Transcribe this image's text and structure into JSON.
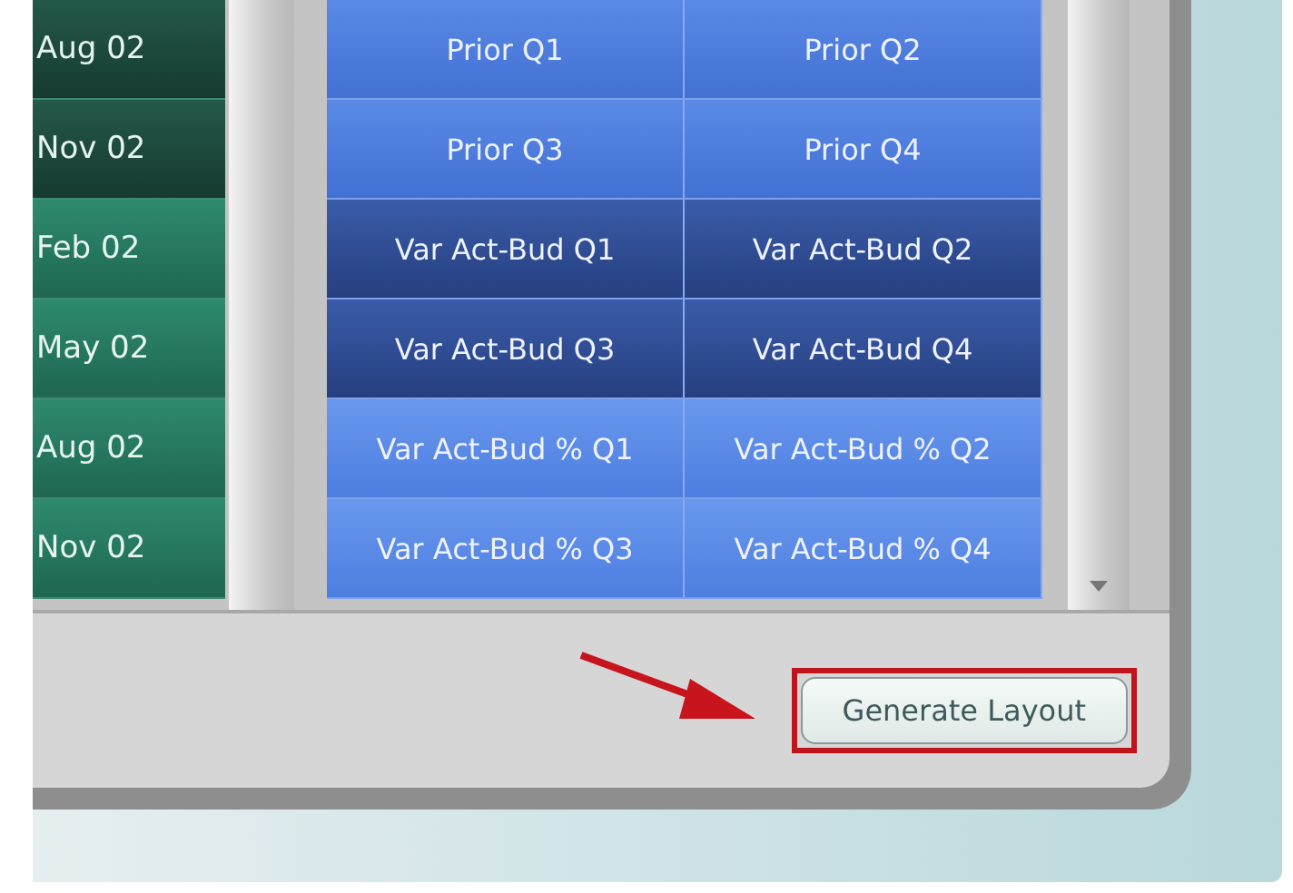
{
  "rows": [
    {
      "period": "Aug 02",
      "kind": "prior",
      "cells": [
        "Prior Q1",
        "Prior Q2"
      ]
    },
    {
      "period": "Nov 02",
      "kind": "prior",
      "cells": [
        "Prior Q3",
        "Prior Q4"
      ]
    },
    {
      "period": "Feb 02",
      "kind": "variance",
      "cells": [
        "Var Act-Bud Q1",
        "Var Act-Bud Q2"
      ]
    },
    {
      "period": "May 02",
      "kind": "variance",
      "cells": [
        "Var Act-Bud Q3",
        "Var Act-Bud Q4"
      ]
    },
    {
      "period": "Aug 02",
      "kind": "percent",
      "cells": [
        "Var Act-Bud % Q1",
        "Var Act-Bud % Q2"
      ]
    },
    {
      "period": "Nov 02",
      "kind": "percent",
      "cells": [
        "Var Act-Bud % Q3",
        "Var Act-Bud % Q4"
      ]
    }
  ],
  "button": {
    "label": "Generate Layout",
    "highlighted": true
  }
}
